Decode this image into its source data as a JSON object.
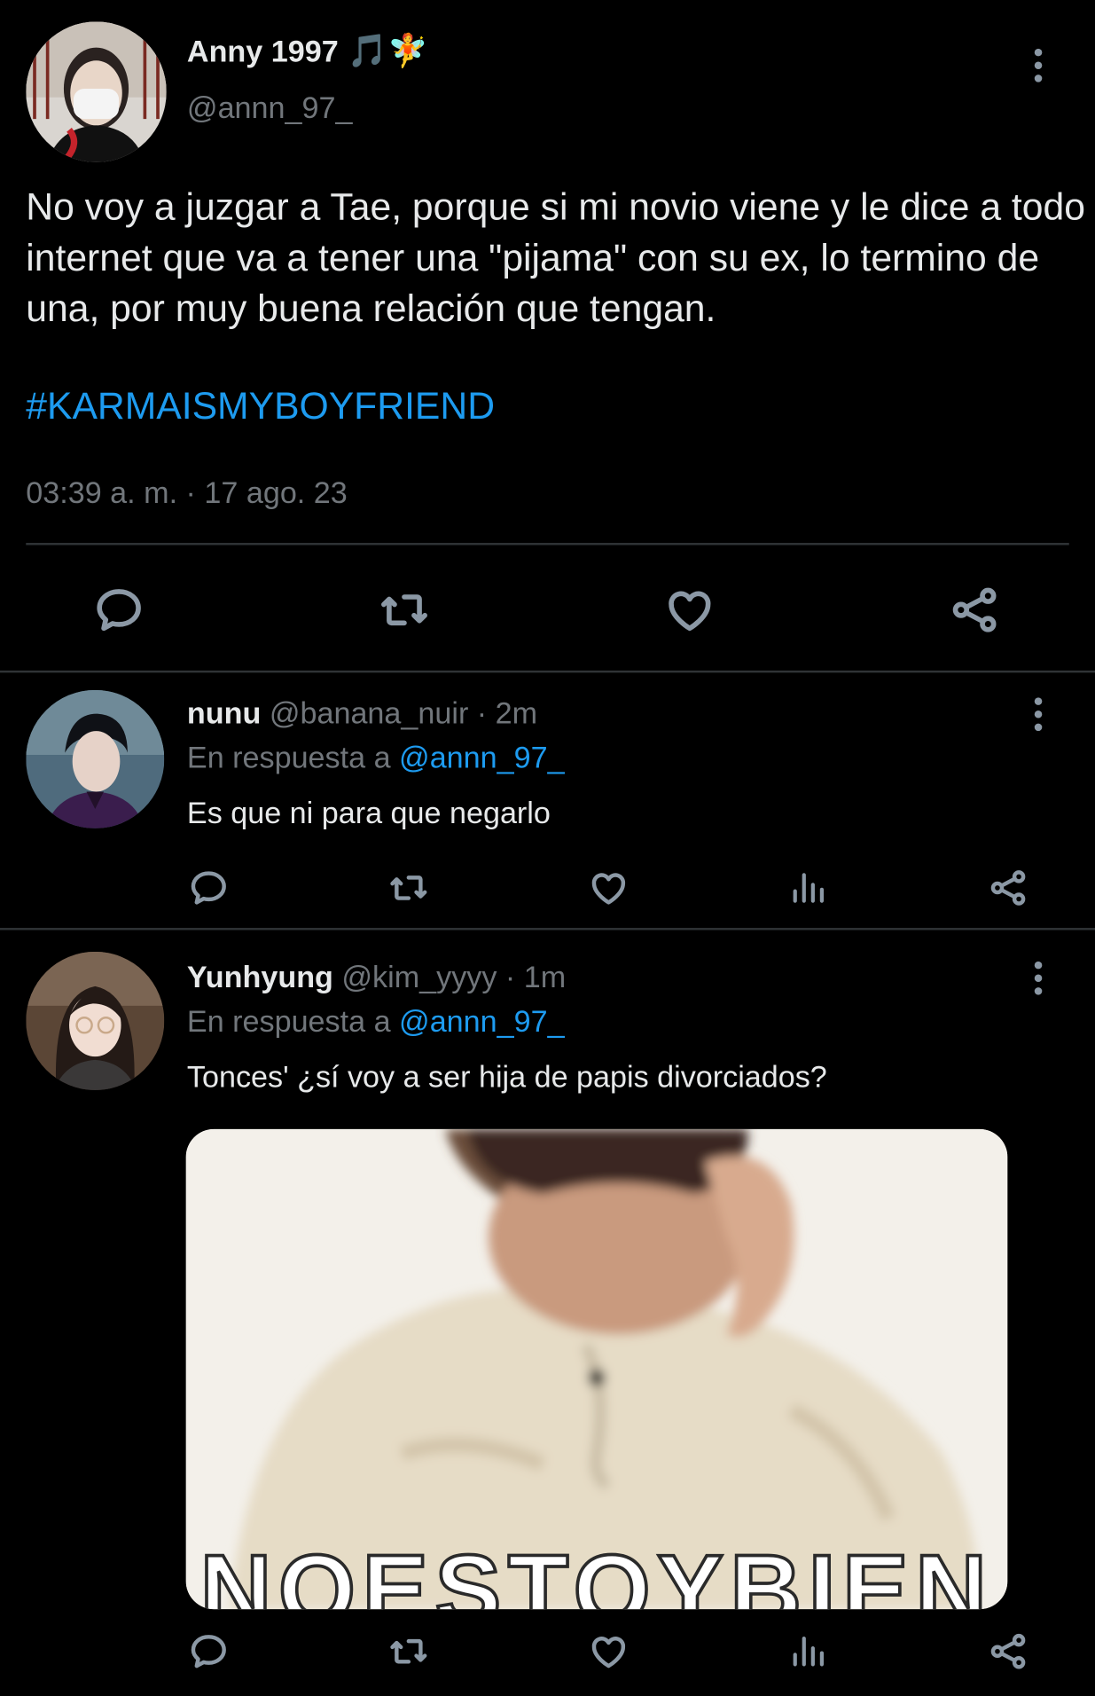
{
  "main_tweet": {
    "display_name": "Anny 1997",
    "name_emojis": "🎵🧚",
    "handle": "@annn_97_",
    "text": "No voy a juzgar a Tae, porque si mi novio viene y le dice a todo internet que va a tener una \"pijama\" con su ex, lo termino de una, por muy buena relación que tengan.",
    "hashtag": "#KARMAISMYBOYFRIEND",
    "timestamp": "03:39 a. m. · 17 ago. 23",
    "actions": [
      "reply-icon",
      "retweet-icon",
      "like-icon",
      "share-icon"
    ]
  },
  "replies": [
    {
      "display_name": "nunu",
      "meta": "@banana_nuir · 2m",
      "reply_prefix": "En respuesta a ",
      "reply_mention": "@annn_97_",
      "text": "Es que ni para que negarlo",
      "actions": [
        "reply-icon",
        "retweet-icon",
        "like-icon",
        "views-icon",
        "share-icon"
      ]
    },
    {
      "display_name": "Yunhyung",
      "meta": "@kim_yyyy · 1m",
      "reply_prefix": "En respuesta a ",
      "reply_mention": "@annn_97_",
      "text": "Tonces' ¿sí voy a ser hija de papis divorciados?",
      "media_caption": "NOESTOYBIEN",
      "actions": [
        "reply-icon",
        "retweet-icon",
        "like-icon",
        "views-icon",
        "share-icon"
      ]
    }
  ],
  "colors": {
    "background": "#000000",
    "text": "#e7e9ea",
    "secondary": "#71767b",
    "accent": "#1d9bf0",
    "divider": "#2f3336"
  }
}
